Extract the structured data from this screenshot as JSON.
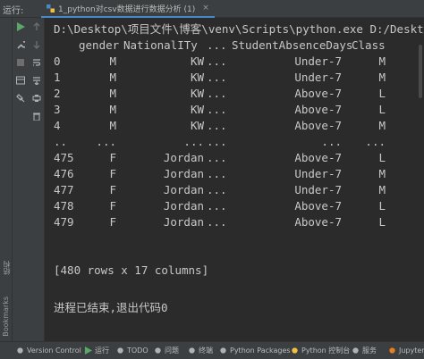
{
  "header": {
    "run_label": "运行:",
    "tab_label": "1_python对csv数据进行数据分析 (1)",
    "tab_close": "×"
  },
  "console": {
    "command_line": "D:\\Desktop\\项目文件\\博客\\venv\\Scripts\\python.exe D:/Desktop/项",
    "columns": [
      "gender",
      "NationalITy",
      "...",
      "StudentAbsenceDays",
      "Class"
    ],
    "rows": [
      {
        "index": "0",
        "gender": "M",
        "nationality": "KW",
        "ellipsis": "...",
        "absence": "Under-7",
        "class": "M"
      },
      {
        "index": "1",
        "gender": "M",
        "nationality": "KW",
        "ellipsis": "...",
        "absence": "Under-7",
        "class": "M"
      },
      {
        "index": "2",
        "gender": "M",
        "nationality": "KW",
        "ellipsis": "...",
        "absence": "Above-7",
        "class": "L"
      },
      {
        "index": "3",
        "gender": "M",
        "nationality": "KW",
        "ellipsis": "...",
        "absence": "Above-7",
        "class": "L"
      },
      {
        "index": "4",
        "gender": "M",
        "nationality": "KW",
        "ellipsis": "...",
        "absence": "Above-7",
        "class": "M"
      },
      {
        "index": "..",
        "gender": "...",
        "nationality": "...",
        "ellipsis": "...",
        "absence": "...",
        "class": "..."
      },
      {
        "index": "475",
        "gender": "F",
        "nationality": "Jordan",
        "ellipsis": "...",
        "absence": "Above-7",
        "class": "L"
      },
      {
        "index": "476",
        "gender": "F",
        "nationality": "Jordan",
        "ellipsis": "...",
        "absence": "Under-7",
        "class": "M"
      },
      {
        "index": "477",
        "gender": "F",
        "nationality": "Jordan",
        "ellipsis": "...",
        "absence": "Under-7",
        "class": "M"
      },
      {
        "index": "478",
        "gender": "F",
        "nationality": "Jordan",
        "ellipsis": "...",
        "absence": "Above-7",
        "class": "L"
      },
      {
        "index": "479",
        "gender": "F",
        "nationality": "Jordan",
        "ellipsis": "...",
        "absence": "Above-7",
        "class": "L"
      }
    ],
    "summary": "[480 rows x 17 columns]",
    "exit_message": "进程已结束,退出代码0"
  },
  "sidebar": {
    "structure_label": "结构",
    "bookmarks_label": "Bookmarks"
  },
  "bottom_tabs": [
    {
      "label": "Version Control",
      "icon": "branch-icon"
    },
    {
      "label": "运行",
      "icon": "play-icon"
    },
    {
      "label": "TODO",
      "icon": "list-icon"
    },
    {
      "label": "问题",
      "icon": "info-icon"
    },
    {
      "label": "终端",
      "icon": "terminal-icon"
    },
    {
      "label": "Python Packages",
      "icon": "packages-icon"
    },
    {
      "label": "Python 控制台",
      "icon": "python-icon"
    },
    {
      "label": "服务",
      "icon": "services-icon"
    },
    {
      "label": "Jupyter",
      "icon": "jupyter-icon"
    }
  ],
  "colors": {
    "background": "#2b2b2b",
    "panel": "#3c3f41",
    "text": "#c8c8c8",
    "accent": "#4a88c7",
    "run_green": "#59a869"
  }
}
